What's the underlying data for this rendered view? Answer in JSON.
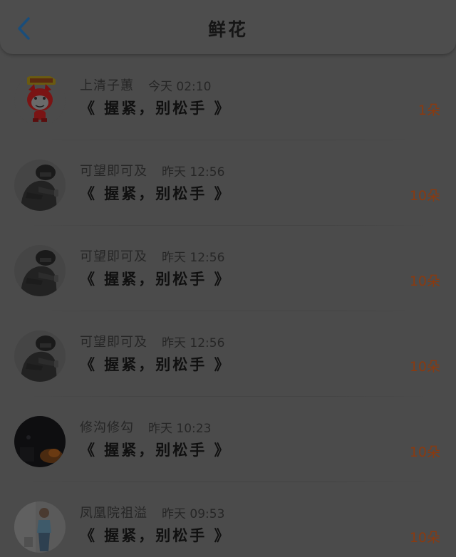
{
  "header": {
    "back_icon": "chevron-left-icon",
    "title": "鲜花",
    "accent_color": "#1a4d7a"
  },
  "rows": [
    {
      "avatar": "fox-cartoon-avatar",
      "name": "上清子蕙",
      "time": "今天 02:10",
      "gift": "《 握紧，别松手 》",
      "count": "1朵"
    },
    {
      "avatar": "motorcyclist-avatar",
      "name": "可望即可及",
      "time": "昨天 12:56",
      "gift": "《 握紧，别松手 》",
      "count": "10朵"
    },
    {
      "avatar": "motorcyclist-avatar",
      "name": "可望即可及",
      "time": "昨天 12:56",
      "gift": "《 握紧，别松手 》",
      "count": "10朵"
    },
    {
      "avatar": "motorcyclist-avatar",
      "name": "可望即可及",
      "time": "昨天 12:56",
      "gift": "《 握紧，别松手 》",
      "count": "10朵"
    },
    {
      "avatar": "dark-night-avatar",
      "name": "修沟修勾",
      "time": "昨天 10:23",
      "gift": "《 握紧，别松手 》",
      "count": "10朵"
    },
    {
      "avatar": "girl-photo-avatar",
      "name": "凤凰院祖溢",
      "time": "昨天 09:53",
      "gift": "《 握紧，别松手 》",
      "count": "10朵"
    }
  ],
  "colors": {
    "count_color": "#8a3a10",
    "overlay_bg": "#4b4b4b"
  }
}
